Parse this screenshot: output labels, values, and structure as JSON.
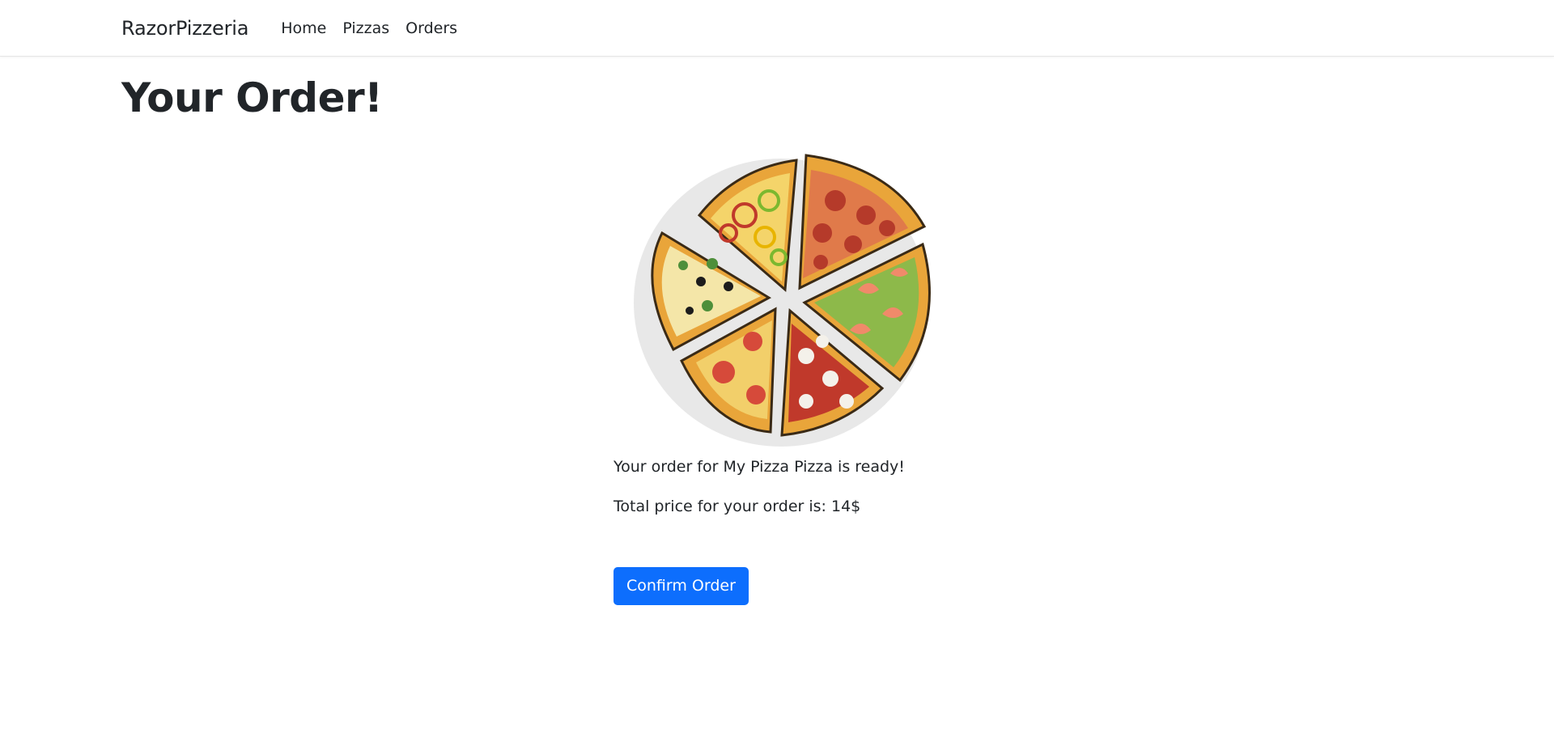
{
  "nav": {
    "brand": "RazorPizzeria",
    "links": [
      "Home",
      "Pizzas",
      "Orders"
    ]
  },
  "main": {
    "title": "Your Order!",
    "image_icon": "pizza-illustration",
    "order_message": "Your order for My Pizza Pizza is ready!",
    "total_message": "Total price for your order is: 14$",
    "confirm_label": "Confirm Order"
  },
  "colors": {
    "primary": "#0d6efd",
    "text": "#212529"
  }
}
